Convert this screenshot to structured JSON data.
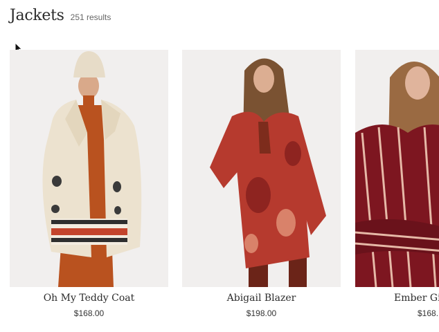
{
  "category": {
    "title": "Jackets",
    "result_count": "251 results"
  },
  "products": [
    {
      "name": "Oh My Teddy Coat",
      "price": "$168.00"
    },
    {
      "name": "Abigail Blazer",
      "price": "$198.00"
    },
    {
      "name": "Ember Gir",
      "price": "$168."
    }
  ],
  "colors": {
    "image_background": "#f1efee",
    "title_text": "#2a2a2a",
    "muted_text": "#666666"
  }
}
